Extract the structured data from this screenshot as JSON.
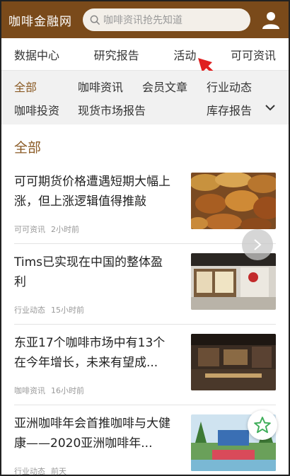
{
  "header": {
    "brand": "咖啡金融网",
    "search_placeholder": "咖啡资讯抢先知道"
  },
  "topnav": {
    "items": [
      "数据中心",
      "研究报告",
      "活动",
      "可可资讯"
    ]
  },
  "categories": {
    "active": "全部",
    "row1": [
      "全部",
      "咖啡资讯",
      "会员文章",
      "行业动态"
    ],
    "row2": [
      "咖啡投资",
      "现货市场报告",
      "库存报告"
    ]
  },
  "section_title": "全部",
  "articles": [
    {
      "title": "可可期货价格遭遇短期大幅上涨，但上涨逻辑值得推敲",
      "category": "可可资讯",
      "time": "2小时前",
      "thumb": "cocoa-pods-image"
    },
    {
      "title": "Tims已实现在中国的整体盈利",
      "category": "行业动态",
      "time": "15小时前",
      "thumb": "tims-store-image"
    },
    {
      "title": "东亚17个咖啡市场中有13个在今年增长，未来有望成...",
      "category": "咖啡资讯",
      "time": "16小时前",
      "thumb": "cafe-interior-image"
    },
    {
      "title": "亚洲咖啡年会首推咖啡与大健康——2020亚洲咖啡年...",
      "category": "行业动态",
      "time": "前天",
      "thumb": "event-venue-image"
    }
  ],
  "colors": {
    "brand": "#7a4a1a",
    "accent": "#8a5a24",
    "annotation_arrow": "#e02020"
  }
}
